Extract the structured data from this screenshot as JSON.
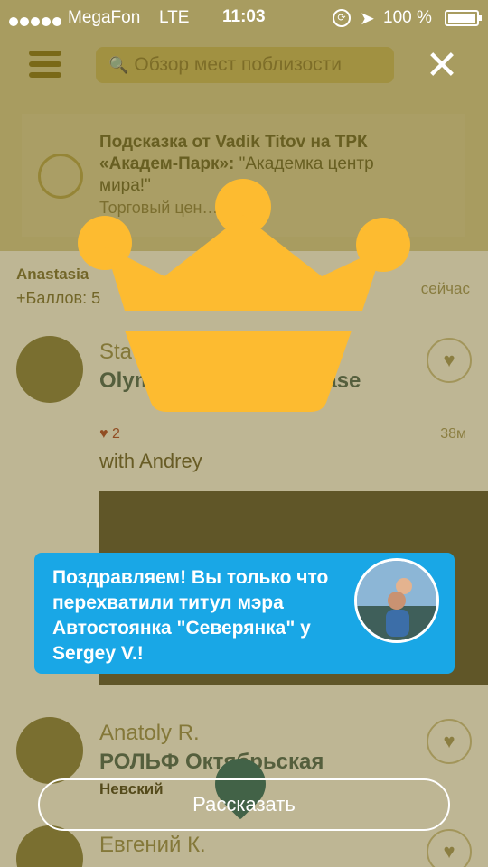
{
  "status_bar": {
    "carrier": "MegaFon",
    "network": "LTE",
    "time": "11:03",
    "battery": "100 %"
  },
  "header": {
    "search_placeholder": "Обзор мест поблизости"
  },
  "tip": {
    "title": "Подсказка от Vadik Titov на ТРК «Академ-Парк»:",
    "quote": " \"Академка центр мира!\"",
    "subtitle": "Торговый цен… 6 км"
  },
  "feed": {
    "points_name": "Anastasia",
    "points": "+Баллов: 5",
    "points_time": "сейчас",
    "items": [
      {
        "user": "Sta…",
        "venue": "Olymp… …ing Showcase",
        "likes": "2",
        "age": "38м",
        "with": "with Andrey"
      },
      {
        "user": "Anatoly R.",
        "venue": "РОЛЬФ Октябрьская",
        "district": "Невский"
      },
      {
        "user": "Евгений К."
      }
    ]
  },
  "overlay": {
    "close_label": "✕",
    "message": "Поздравляем! Вы только что перехватили титул мэра Автостоянка \"Северянка\" у Sergey V.!",
    "share_label": "Рассказать",
    "crown_color": "#fdbb30",
    "toast_color": "#19a7e6"
  }
}
